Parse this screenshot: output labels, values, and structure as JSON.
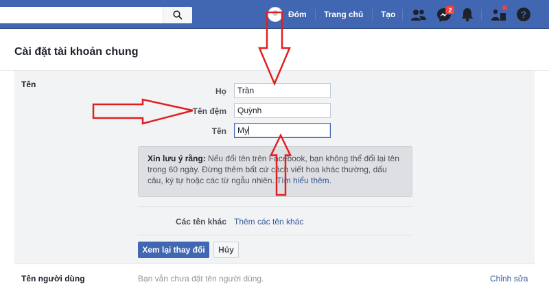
{
  "topbar": {
    "profile_name": "Đóm",
    "home_label": "Trang chủ",
    "create_label": "Tạo",
    "messages_badge": "2",
    "colors": {
      "bar": "#4267b2",
      "badge": "#fa3e3e"
    }
  },
  "page": {
    "title": "Cài đặt tài khoản chung"
  },
  "name_section": {
    "label": "Tên",
    "fields": {
      "last_name": {
        "label": "Họ",
        "value": "Trần"
      },
      "middle_name": {
        "label": "Tên đệm",
        "value": "Quỳnh"
      },
      "first_name": {
        "label": "Tên",
        "value": "My"
      }
    },
    "note": {
      "bold": "Xin lưu ý rằng:",
      "text": " Nếu đổi tên trên Facebook, bạn không thể đổi lại tên trong 60 ngày. Đừng thêm bất cứ cách viết hoa khác thường, dấu câu, ký tự hoặc các từ ngẫu nhiên. ",
      "link": "Tìm hiểu thêm."
    },
    "other_names": {
      "label": "Các tên khác",
      "link": "Thêm các tên khác"
    },
    "review_button": "Xem lại thay đổi",
    "cancel_button": "Hủy"
  },
  "username_row": {
    "label": "Tên người dùng",
    "value": "Bạn vẫn chưa đặt tên người dùng.",
    "edit": "Chỉnh sửa"
  },
  "annotations": {
    "arrow_color": "#e02020",
    "arrow_count": 3
  }
}
